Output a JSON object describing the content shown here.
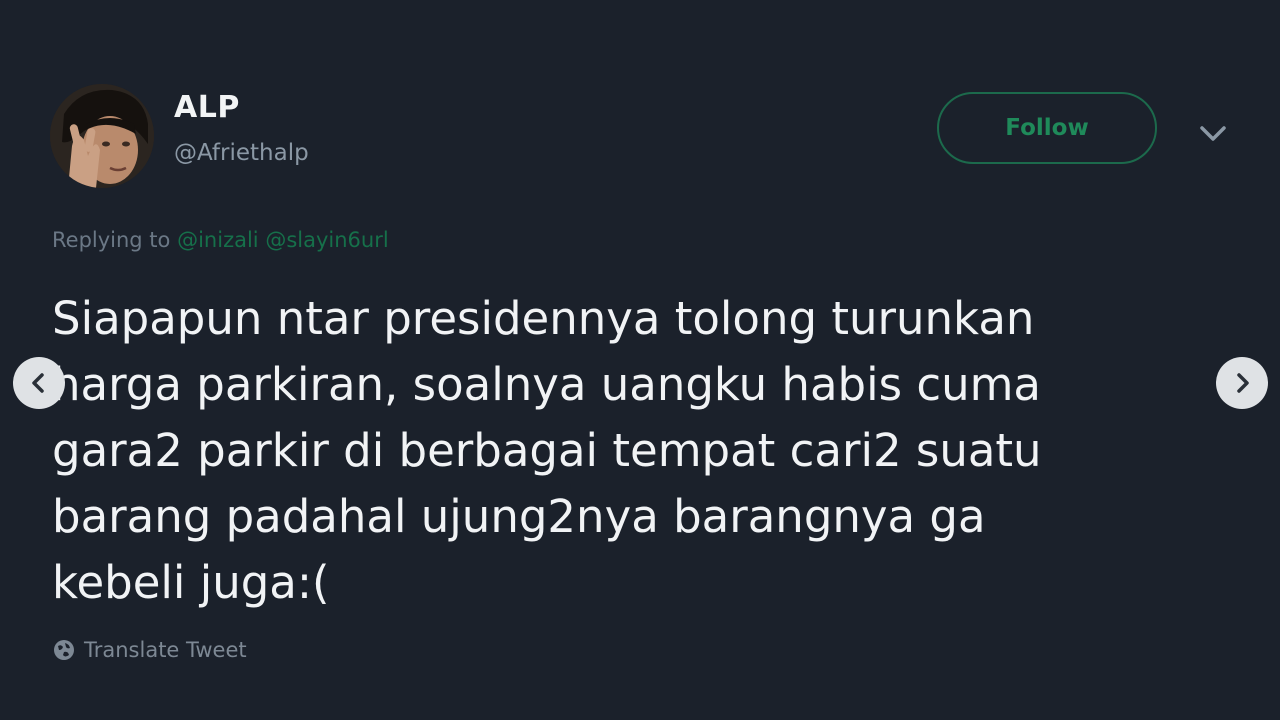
{
  "user": {
    "display_name": "ALP",
    "handle": "@Afriethalp"
  },
  "actions": {
    "follow_label": "Follow"
  },
  "reply": {
    "prefix": "Replying to",
    "mentions": [
      "@inizali",
      "@slayin6url"
    ]
  },
  "tweet": {
    "text": "Siapapun ntar presidennya tolong turunkan\nharga parkiran, soalnya uangku habis cuma\ngara2 parkir di berbagai tempat cari2 suatu\nbarang padahal ujung2nya barangnya ga\nkebeli juga:("
  },
  "translate": {
    "label": "Translate Tweet"
  },
  "icons": {
    "avatar": "profile-photo",
    "chevron": "chevron-down-icon",
    "prev": "chevron-left-icon",
    "next": "chevron-right-icon",
    "translate": "globe-icon"
  },
  "colors": {
    "background": "#1b212b",
    "accent_green": "#1f8a5a",
    "text_primary": "#f1f3f5",
    "text_secondary": "#8b98a5"
  }
}
